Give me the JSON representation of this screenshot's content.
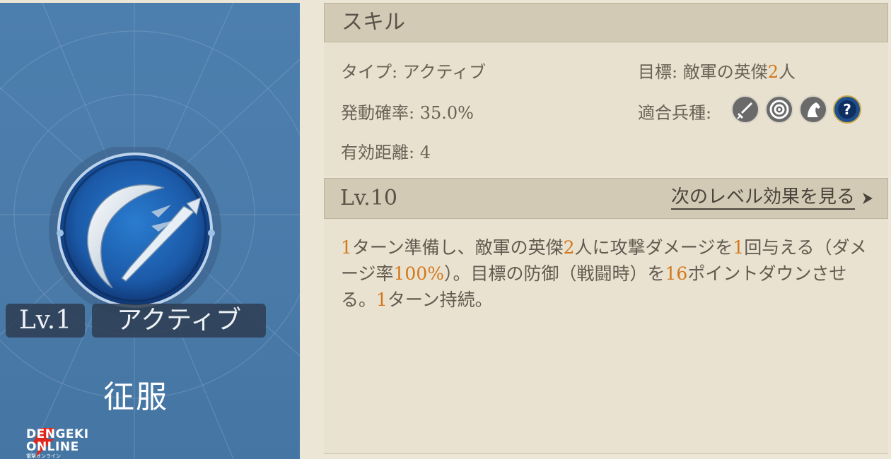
{
  "card": {
    "level_badge": "Lv.1",
    "type_badge": "アクティブ",
    "skill_name": "征服",
    "logo_line1": "DENGEKI",
    "logo_line2": "ONLINE",
    "logo_line3": "電撃オンライン"
  },
  "skill_panel": {
    "header": "スキル",
    "type_label": "タイプ:",
    "type_value": "アクティブ",
    "target_label": "目標:",
    "target_prefix": "敵軍の英傑",
    "target_count": "2",
    "target_suffix": "人",
    "rate_label": "発動確率:",
    "rate_value": "35.0%",
    "units_label": "適合兵種:",
    "units": [
      "sword-icon",
      "target-icon",
      "horse-icon",
      "question-icon"
    ],
    "range_label": "有効距離:",
    "range_value": "4"
  },
  "level_bar": {
    "level": "Lv.10",
    "next_label": "次のレベル効果を見る"
  },
  "description": {
    "p1": "1",
    "t1": "ターン準備し、敵軍の英傑",
    "p2": "2",
    "t2": "人に攻撃ダメージを",
    "p3": "1",
    "t3": "回与える（ダメージ率",
    "p4": "100%",
    "t4": "）。目標の防御（戦闘時）を",
    "p5": "16",
    "t5": "ポイントダウンさせる。",
    "p6": "1",
    "t6": "ターン持続。"
  },
  "colors": {
    "card_blue": "#4a7aa8",
    "highlight": "#d3771c",
    "panel_bg": "#e8e1cf",
    "header_bg": "#d3cab5"
  }
}
